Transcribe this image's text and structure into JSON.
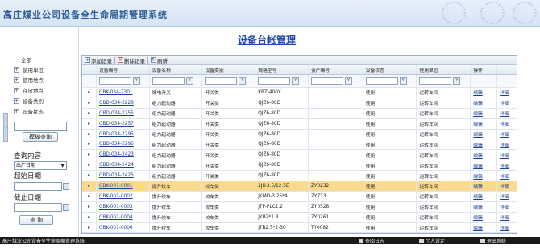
{
  "header": {
    "app_title": "高庄煤业公司设备全生命周期管理系统"
  },
  "sidebar": {
    "tree_root": "全部",
    "tree_items": [
      {
        "label": "使用单位"
      },
      {
        "label": "使用地点"
      },
      {
        "label": "存放地点"
      },
      {
        "label": "设备类别"
      },
      {
        "label": "设备状态"
      }
    ],
    "search_value": "",
    "fuzzy_search_button": "模糊查询",
    "query_content_label": "查询内容",
    "query_field_selected": "出厂日期",
    "start_date_label": "起始日期",
    "start_date_value": "",
    "end_date_label": "截止日期",
    "end_date_value": "",
    "query_button": "查  询"
  },
  "main": {
    "page_title": "设备台帐管理",
    "toolbar": {
      "add_label": "添加记录",
      "delete_label": "删除记录",
      "refresh_label": "刷新"
    },
    "columns": [
      "设备编号",
      "设备名称",
      "设备类别",
      "规格型号",
      "资产编号",
      "设备状态",
      "使用单位",
      "操作"
    ],
    "rows": [
      {
        "code": "GBK-034-7301",
        "name": "馈电开关",
        "category": "开关类",
        "model": "KBZ-400Y",
        "asset": "",
        "status": "使用",
        "unit": "运转车间",
        "edit": "编辑",
        "detail": "详细"
      },
      {
        "code": "GBD-034-2228",
        "name": "组力起动器",
        "category": "开关类",
        "model": "QJZ6-80D",
        "asset": "",
        "status": "使用",
        "unit": "运转车间",
        "edit": "编辑",
        "detail": "详细"
      },
      {
        "code": "GBD-034-2255",
        "name": "组力起动器",
        "category": "开关类",
        "model": "QJZ6-80D",
        "asset": "",
        "status": "使用",
        "unit": "运转车间",
        "edit": "编辑",
        "detail": "详细"
      },
      {
        "code": "GBD-034-2257",
        "name": "组力起动器",
        "category": "开关类",
        "model": "QJZ6-80D",
        "asset": "",
        "status": "使用",
        "unit": "运转车间",
        "edit": "编辑",
        "detail": "详细"
      },
      {
        "code": "GBD-034-2295",
        "name": "组力起动器",
        "category": "开关类",
        "model": "QJZ6-80D",
        "asset": "",
        "status": "使用",
        "unit": "运转车间",
        "edit": "编辑",
        "detail": "详细"
      },
      {
        "code": "GBD-034-2296",
        "name": "组力起动器",
        "category": "开关类",
        "model": "QJZ6-80D",
        "asset": "",
        "status": "使用",
        "unit": "运转车间",
        "edit": "编辑",
        "detail": "详细"
      },
      {
        "code": "GBD-034-2423",
        "name": "组力起动器",
        "category": "开关类",
        "model": "QJZ6-80D",
        "asset": "",
        "status": "使用",
        "unit": "运转车间",
        "edit": "编辑",
        "detail": "详细"
      },
      {
        "code": "GBD-034-2424",
        "name": "组力起动器",
        "category": "开关类",
        "model": "QJZ6-80D",
        "asset": "",
        "status": "使用",
        "unit": "运转车间",
        "edit": "编辑",
        "detail": "详细"
      },
      {
        "code": "GBD-034-2425",
        "name": "组力起动器",
        "category": "开关类",
        "model": "QJZ6-80D",
        "asset": "",
        "status": "使用",
        "unit": "运转车间",
        "edit": "编辑",
        "detail": "详细"
      },
      {
        "code": "GBK-001-0001",
        "name": "提升绞车",
        "category": "绞车类",
        "model": "2JK-3.5/12.5E",
        "asset": "ZY0232",
        "status": "使用",
        "unit": "运转车间",
        "edit": "编辑",
        "detail": "详细"
      },
      {
        "code": "GBK-001-0002",
        "name": "提升绞车",
        "category": "绞车类",
        "model": "JKMD-3.25*4",
        "asset": "ZY713",
        "status": "使用",
        "unit": "运转车间",
        "edit": "编辑",
        "detail": "详细"
      },
      {
        "code": "GBK-001-0003",
        "name": "提升绞车",
        "category": "绞车类",
        "model": "JTP-PLC1.2",
        "asset": "ZY0528",
        "status": "使用",
        "unit": "运转车间",
        "edit": "编辑",
        "detail": "详细"
      },
      {
        "code": "GBK-001-0004",
        "name": "提升绞车",
        "category": "绞车类",
        "model": "JKB2*1.8",
        "asset": "ZY0261",
        "status": "使用",
        "unit": "运转车间",
        "edit": "编辑",
        "detail": "详细"
      },
      {
        "code": "GBK-001-0006",
        "name": "提升绞车",
        "category": "绞车类",
        "model": "JTB2.5*2-30",
        "asset": "TY0082",
        "status": "使用",
        "unit": "运转车间",
        "edit": "编辑",
        "detail": "详细"
      }
    ]
  },
  "statusbar": {
    "title": "高庄煤业公司设备全生命周期管理系统",
    "log_label": "查阅日志",
    "settings_label": "个人设定",
    "logout_label": "退出系统"
  }
}
